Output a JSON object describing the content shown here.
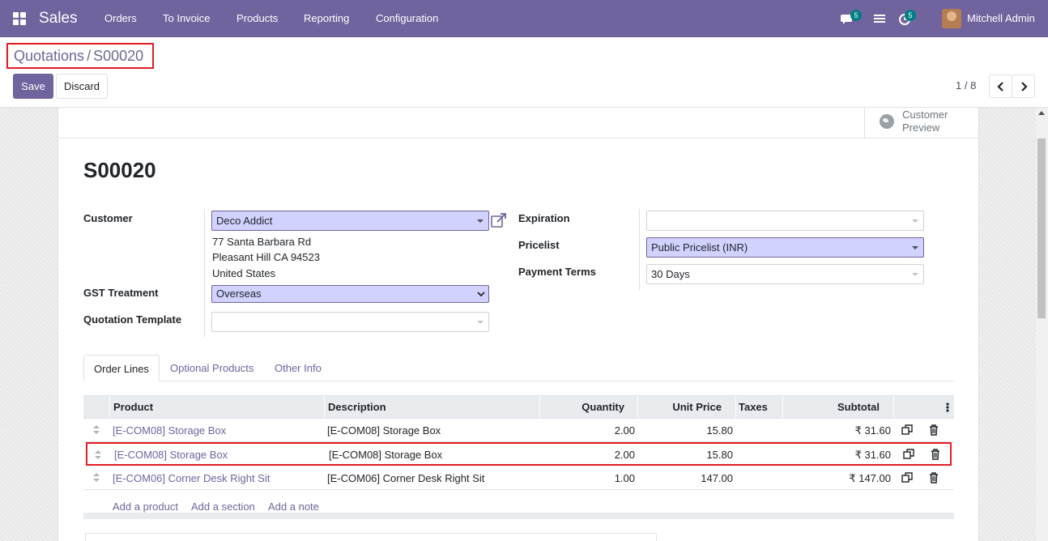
{
  "navbar": {
    "app_name": "Sales",
    "menu": [
      "Orders",
      "To Invoice",
      "Products",
      "Reporting",
      "Configuration"
    ],
    "messages_count": "5",
    "activities_count": "5",
    "user_name": "Mitchell Admin"
  },
  "control_panel": {
    "breadcrumb_parent": "Quotations",
    "breadcrumb_separator": "/",
    "breadcrumb_current": "S00020",
    "save_label": "Save",
    "discard_label": "Discard",
    "pager_value": "1 / 8"
  },
  "form": {
    "customer_preview_label": "Customer Preview",
    "title": "S00020",
    "customer_label": "Customer",
    "customer_value": "Deco Addict",
    "address_line1": "77 Santa Barbara Rd",
    "address_line2": "Pleasant Hill CA 94523",
    "address_line3": "United States",
    "gst_treatment_label": "GST Treatment",
    "gst_treatment_value": "Overseas",
    "quotation_template_label": "Quotation Template",
    "quotation_template_value": "",
    "expiration_label": "Expiration",
    "expiration_value": "",
    "pricelist_label": "Pricelist",
    "pricelist_value": "Public Pricelist (INR)",
    "payment_terms_label": "Payment Terms",
    "payment_terms_value": "30 Days"
  },
  "tabs": [
    "Order Lines",
    "Optional Products",
    "Other Info"
  ],
  "order_lines": {
    "columns": [
      "Product",
      "Description",
      "Quantity",
      "Unit Price",
      "Taxes",
      "Subtotal"
    ],
    "rows": [
      {
        "product": "[E-COM08] Storage Box",
        "description": "[E-COM08] Storage Box",
        "quantity": "2.00",
        "unit_price": "15.80",
        "taxes": "",
        "subtotal": "₹ 31.60"
      },
      {
        "product": "[E-COM08] Storage Box",
        "description": "[E-COM08] Storage Box",
        "quantity": "2.00",
        "unit_price": "15.80",
        "taxes": "",
        "subtotal": "₹ 31.60"
      },
      {
        "product": "[E-COM06] Corner Desk Right Sit",
        "description": "[E-COM06] Corner Desk Right Sit",
        "quantity": "1.00",
        "unit_price": "147.00",
        "taxes": "",
        "subtotal": "₹ 147.00"
      }
    ],
    "add_product": "Add a product",
    "add_section": "Add a section",
    "add_note": "Add a note"
  },
  "colors": {
    "brand": "#71639e",
    "required_field": "#d2d2ff",
    "highlight_border": "#e31b23",
    "badge": "#017e84"
  }
}
